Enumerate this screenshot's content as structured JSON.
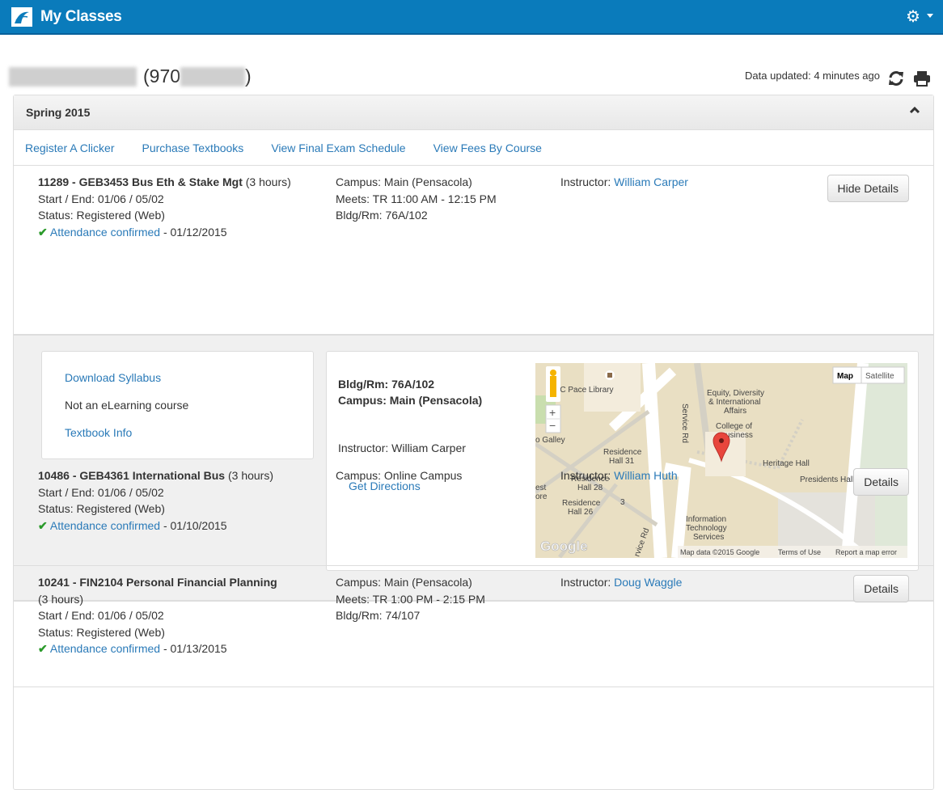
{
  "app": {
    "title": "My Classes",
    "logo": "university-logo",
    "settings_icon": "gear-icon"
  },
  "student": {
    "id_prefix": "(970",
    "id_suffix": ")"
  },
  "status": {
    "updated": "Data updated: 4 minutes ago"
  },
  "term": {
    "title": "Spring 2015"
  },
  "links": [
    "Register A Clicker",
    "Purchase Textbooks",
    "View Final Exam Schedule",
    "View Fees By Course"
  ],
  "courses": [
    {
      "title": "11289 - GEB3453 Bus Eth & Stake Mgt",
      "hours": " (3 hours)",
      "dates": "Start / End: 01/06 / 05/02",
      "status": "Status: Registered (Web)",
      "attendance": "Attendance confirmed",
      "attendance_date": " - 01/12/2015",
      "campus": "Campus: Main (Pensacola)",
      "meets": "Meets: TR 11:00 AM - 12:15 PM",
      "room": "Bldg/Rm: 76A/102",
      "instructor_label": "Instructor: ",
      "instructor": "William Carper",
      "button": "Hide Details"
    },
    {
      "title": "10486 - GEB4361 International Bus",
      "hours": " (3 hours)",
      "dates": "Start / End: 01/06 / 05/02",
      "status": "Status: Registered (Web)",
      "attendance": "Attendance confirmed",
      "attendance_date": " - 01/10/2015",
      "campus": "Campus: Online Campus",
      "instructor_label": "Instructor: ",
      "instructor": "William Huth",
      "button": "Details"
    },
    {
      "title": "10241 - FIN2104 Personal Financial Planning",
      "hours": "(3 hours)",
      "dates": "Start / End: 01/06 / 05/02",
      "status": "Status: Registered (Web)",
      "attendance": "Attendance confirmed",
      "attendance_date": " - 01/13/2015",
      "campus": "Campus: Main (Pensacola)",
      "meets": "Meets: TR 1:00 PM - 2:15 PM",
      "room": "Bldg/Rm: 74/107",
      "instructor_label": "Instructor: ",
      "instructor": "Doug Waggle",
      "button": "Details"
    }
  ],
  "details": {
    "syllabus": "Download Syllabus",
    "elearning": "Not an eLearning course",
    "textbook": "Textbook Info",
    "room": "Bldg/Rm: 76A/102",
    "campus": "Campus: Main (Pensacola)",
    "instructor": "Instructor: William Carper",
    "directions": "Get Directions"
  },
  "map": {
    "type_map": "Map",
    "type_satellite": "Satellite",
    "zoom_in": "+",
    "zoom_out": "−",
    "labels": [
      "n C Pace Library",
      "Equity, Diversity",
      "& International",
      "Affairs",
      "College of",
      "usiness",
      "Service Rd",
      "o Galley",
      "Residence",
      "Hall 31",
      "Residence",
      "Hall 28",
      "Residence",
      "Hall 26",
      "est",
      "ore",
      "3",
      "Heritage Hall",
      "Presidents Hall",
      "Information",
      "Technology",
      "Services",
      "rvice Rd"
    ],
    "google": "Google",
    "attribution": "Map data ©2015 Google",
    "terms": "Terms of Use",
    "report": "Report a map error",
    "marker_color": "#e8463c"
  },
  "colors": {
    "header": "#0a7bbb",
    "link": "#2a7ab8",
    "check": "#2a9a2a"
  }
}
